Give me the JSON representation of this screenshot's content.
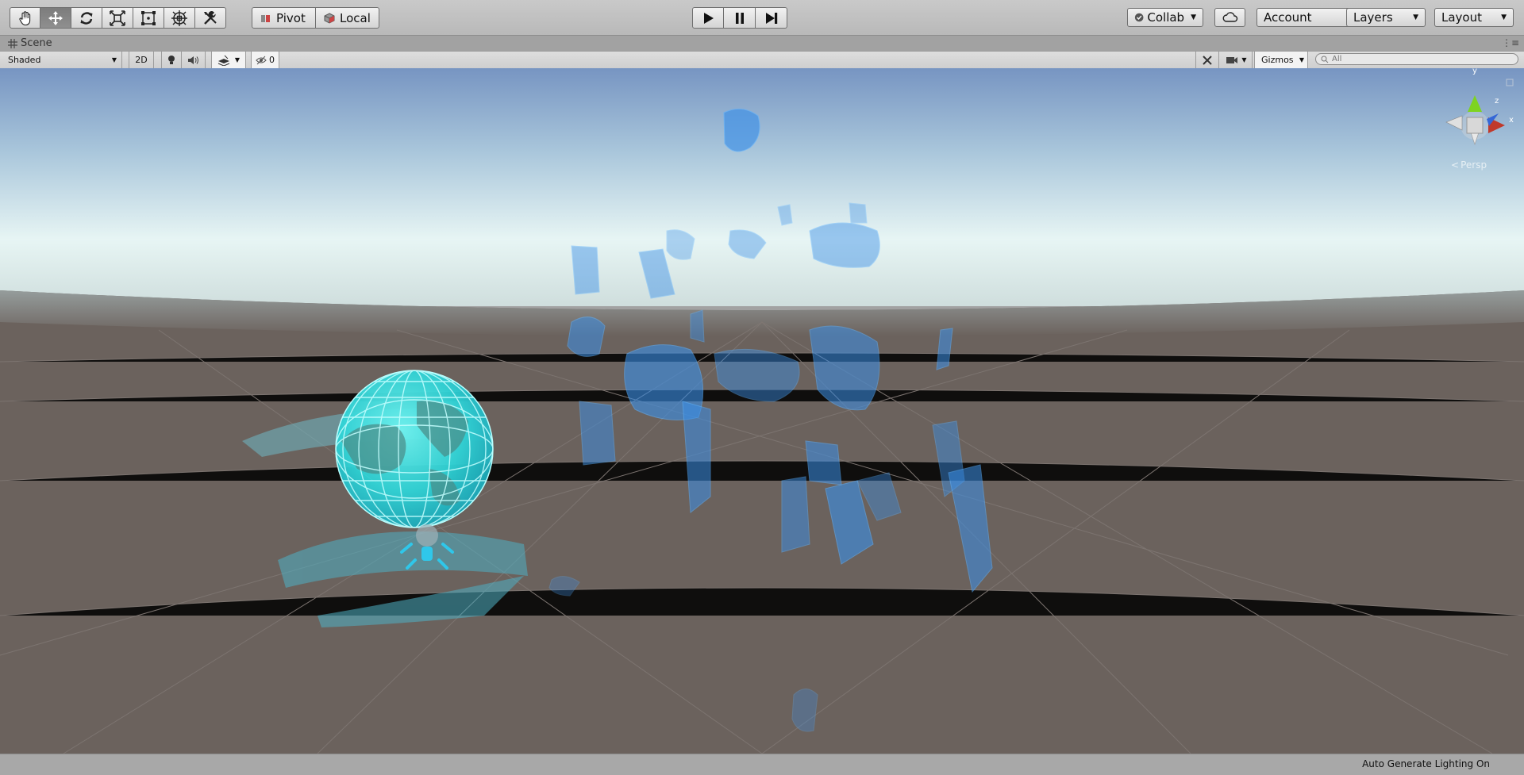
{
  "toolbar": {
    "tools": [
      {
        "name": "hand-tool",
        "icon": "hand-icon"
      },
      {
        "name": "move-tool",
        "icon": "move-arrows-icon",
        "active": true
      },
      {
        "name": "rotate-tool",
        "icon": "rotate-icon"
      },
      {
        "name": "scale-tool",
        "icon": "scale-icon"
      },
      {
        "name": "rect-tool",
        "icon": "rect-transform-icon"
      },
      {
        "name": "transform-tool",
        "icon": "transform-icon"
      },
      {
        "name": "custom-tool",
        "icon": "wrench-icon"
      }
    ],
    "pivot_label": "Pivot",
    "local_label": "Local",
    "collab_label": "Collab",
    "account_label": "Account",
    "layers_label": "Layers",
    "layout_label": "Layout"
  },
  "scene_tab": {
    "label": "Scene"
  },
  "scene_toolbar": {
    "shading_mode": "Shaded",
    "two_d_label": "2D",
    "hidden_count": "0",
    "gizmos_label": "Gizmos",
    "search_placeholder": "All"
  },
  "viewport": {
    "persp_label": "Persp",
    "axis_labels": {
      "y": "y",
      "z": "z",
      "x": "x"
    }
  },
  "status_bar": {
    "message": "Auto Generate Lighting On"
  },
  "colors": {
    "toolbar_bg": "#c0c0c0",
    "ground": "#6b625d",
    "sky_top": "#7b97c4",
    "horizon": "#e4f3f3",
    "hologram": "#2fe6e6",
    "character_blue": "#3a8fe8",
    "gizmo_y": "#7ed321",
    "gizmo_x": "#c0392b",
    "gizmo_z": "#3567d6"
  }
}
